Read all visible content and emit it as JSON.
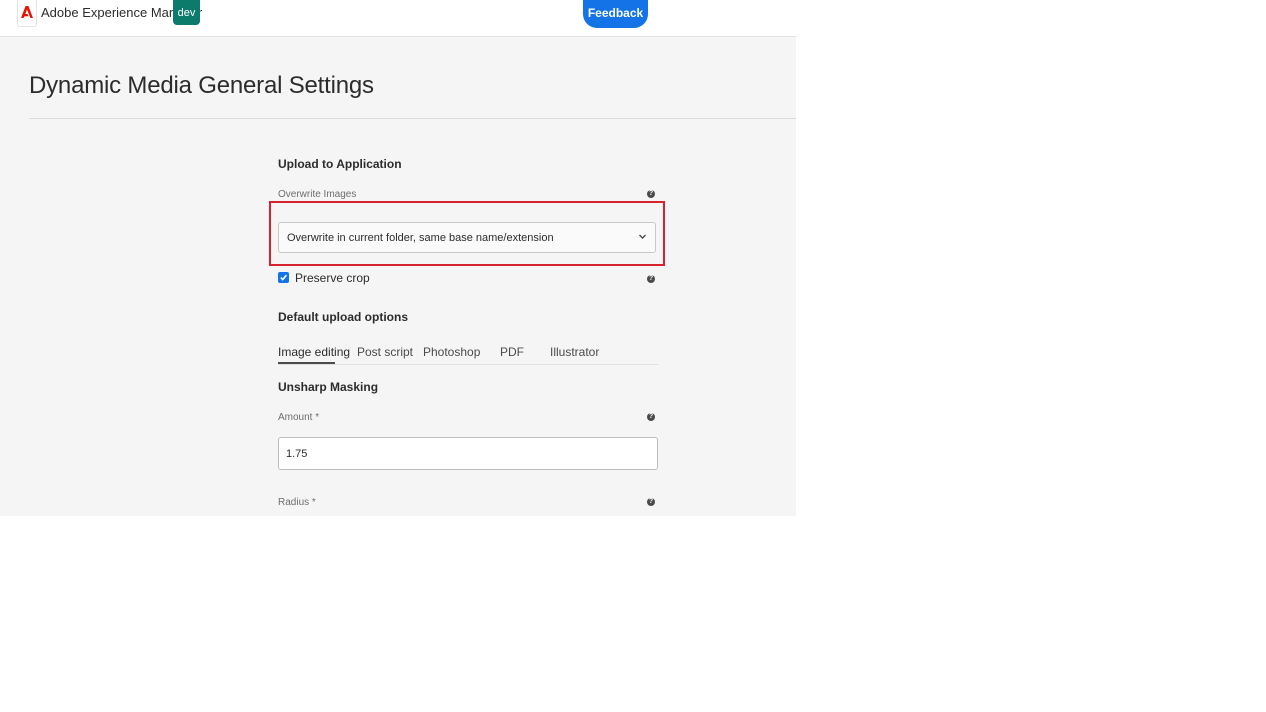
{
  "header": {
    "app_name": "Adobe Experience Manager",
    "environment": "dev",
    "feedback_label": "Feedback"
  },
  "page": {
    "title": "Dynamic Media General Settings"
  },
  "upload": {
    "section_title": "Upload to Application",
    "overwrite_label": "Overwrite Images",
    "overwrite_value": "Overwrite in current folder, same base name/extension",
    "preserve_crop_label": "Preserve crop",
    "preserve_crop_checked": true
  },
  "defaults": {
    "section_title": "Default upload options",
    "tabs": [
      "Image editing",
      "Post script",
      "Photoshop",
      "PDF",
      "Illustrator"
    ],
    "active_tab": "Image editing"
  },
  "unsharp": {
    "section_title": "Unsharp Masking",
    "amount_label": "Amount *",
    "amount_value": "1.75",
    "radius_label": "Radius *"
  },
  "help_glyph": "?",
  "colors": {
    "accent": "#1473e6",
    "env_badge": "#0d7b6c",
    "highlight": "#d7232f",
    "adobe_red": "#eb1000"
  }
}
